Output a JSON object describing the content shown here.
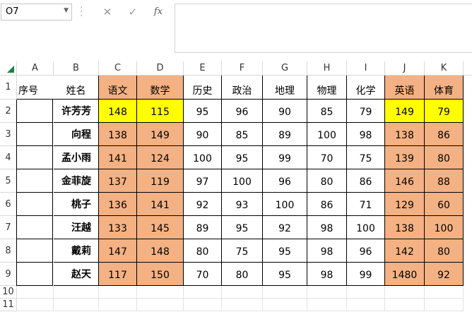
{
  "name_box": {
    "value": "O7"
  },
  "formula_bar": {
    "cancel_symbol": "✕",
    "enter_symbol": "✓",
    "fx_label": "fx",
    "content": ""
  },
  "columns": [
    "A",
    "B",
    "C",
    "D",
    "E",
    "F",
    "G",
    "H",
    "I",
    "J",
    "K"
  ],
  "rows": [
    "1",
    "2",
    "3",
    "4",
    "5",
    "6",
    "7",
    "8",
    "9",
    "10",
    "11"
  ],
  "header_row": [
    "序号",
    "姓名",
    "语文",
    "数学",
    "历史",
    "政治",
    "地理",
    "物理",
    "化学",
    "英语",
    "体育"
  ],
  "data_rows": [
    {
      "name": "许芳芳",
      "scores": [
        "148",
        "115",
        "95",
        "96",
        "90",
        "85",
        "79",
        "149",
        "79"
      ]
    },
    {
      "name": "向程",
      "scores": [
        "138",
        "149",
        "90",
        "85",
        "89",
        "100",
        "98",
        "138",
        "86"
      ]
    },
    {
      "name": "孟小雨",
      "scores": [
        "141",
        "124",
        "100",
        "95",
        "99",
        "70",
        "75",
        "139",
        "80"
      ]
    },
    {
      "name": "金菲旋",
      "scores": [
        "137",
        "119",
        "97",
        "100",
        "96",
        "80",
        "86",
        "146",
        "88"
      ]
    },
    {
      "name": "桃子",
      "scores": [
        "136",
        "141",
        "92",
        "93",
        "100",
        "86",
        "71",
        "129",
        "60"
      ]
    },
    {
      "name": "汪越",
      "scores": [
        "133",
        "145",
        "89",
        "95",
        "92",
        "98",
        "100",
        "138",
        "100"
      ]
    },
    {
      "name": "戴莉",
      "scores": [
        "147",
        "148",
        "80",
        "75",
        "95",
        "98",
        "96",
        "142",
        "80"
      ]
    },
    {
      "name": "赵天",
      "scores": [
        "117",
        "150",
        "70",
        "80",
        "95",
        "98",
        "99",
        "1480",
        "92"
      ]
    }
  ],
  "colors": {
    "orange": "#f4b183",
    "yellow": "#ffff00",
    "corner_triangle": "#208040"
  }
}
